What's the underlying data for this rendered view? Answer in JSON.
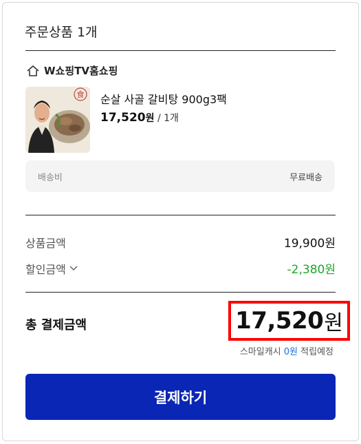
{
  "order": {
    "title": "주문상품 1개",
    "shop_name": "W쇼핑TV홈쇼핑",
    "product": {
      "name": "순살 사골 갈비탕 900g3팩",
      "price": "17,520",
      "price_unit": "원",
      "quantity": "/ 1개"
    },
    "shipping": {
      "label": "배송비",
      "value": "무료배송"
    }
  },
  "summary": {
    "product_amount_label": "상품금액",
    "product_amount_value": "19,900원",
    "discount_label": "할인금액",
    "discount_value": "-2,380원",
    "total_label": "총 결제금액",
    "total_value": "17,520",
    "total_unit": "원",
    "cash_prefix": "스마일캐시",
    "cash_amount": "0원",
    "cash_suffix": "적립예정"
  },
  "pay_button_label": "결제하기",
  "colors": {
    "accent": "#0a26b5",
    "discount": "#1fa42c",
    "highlight": "#ff0000",
    "cash": "#1f6fd6"
  },
  "icons": {
    "shop": "home-icon",
    "discount_toggle": "chevron-down-icon"
  }
}
